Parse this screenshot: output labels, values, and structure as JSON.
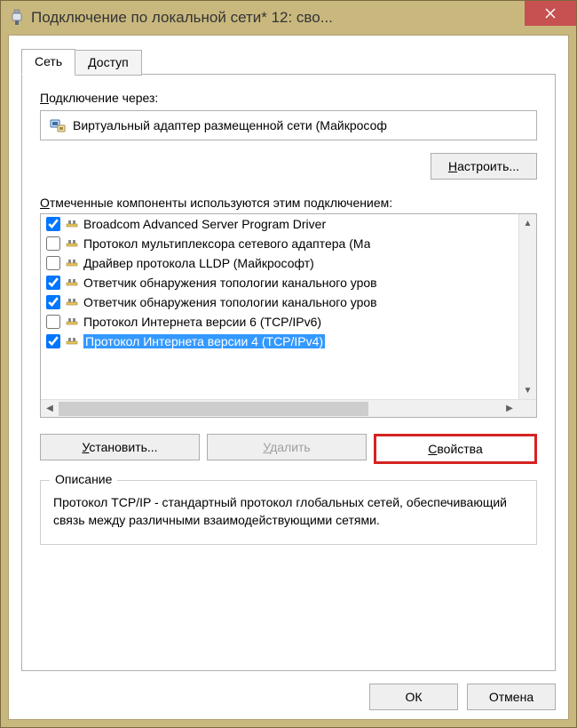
{
  "window": {
    "title": "Подключение по локальной сети* 12: сво..."
  },
  "tabs": {
    "network": "Сеть",
    "access": "Доступ"
  },
  "connect_via": {
    "label_pre": "П",
    "label_rest": "одключение через:",
    "adapter": "Виртуальный адаптер размещенной сети (Майкрософ"
  },
  "configure_btn": {
    "pre": "Н",
    "rest": "астроить..."
  },
  "components": {
    "label_pre": "О",
    "label_rest": "тмеченные компоненты используются этим подключением:",
    "items": [
      {
        "checked": true,
        "label": "Broadcom Advanced Server Program Driver",
        "selected": false
      },
      {
        "checked": false,
        "label": "Протокол мультиплексора сетевого адаптера (Ма",
        "selected": false
      },
      {
        "checked": false,
        "label": "Драйвер протокола LLDP (Майкрософт)",
        "selected": false
      },
      {
        "checked": true,
        "label": "Ответчик обнаружения топологии канального уров",
        "selected": false
      },
      {
        "checked": true,
        "label": "Ответчик обнаружения топологии канального уров",
        "selected": false
      },
      {
        "checked": false,
        "label": "Протокол Интернета версии 6 (TCP/IPv6)",
        "selected": false
      },
      {
        "checked": true,
        "label": "Протокол Интернета версии 4 (TCP/IPv4)",
        "selected": true
      }
    ]
  },
  "action_buttons": {
    "install": {
      "pre": "У",
      "rest": "становить..."
    },
    "remove": {
      "pre": "У",
      "rest": "далить"
    },
    "props": {
      "pre": "С",
      "rest": "войства"
    }
  },
  "description": {
    "title": "Описание",
    "text": "Протокол TCP/IP - стандартный протокол глобальных сетей, обеспечивающий связь между различными взаимодействующими сетями."
  },
  "dialog_buttons": {
    "ok": "ОК",
    "cancel": "Отмена"
  }
}
